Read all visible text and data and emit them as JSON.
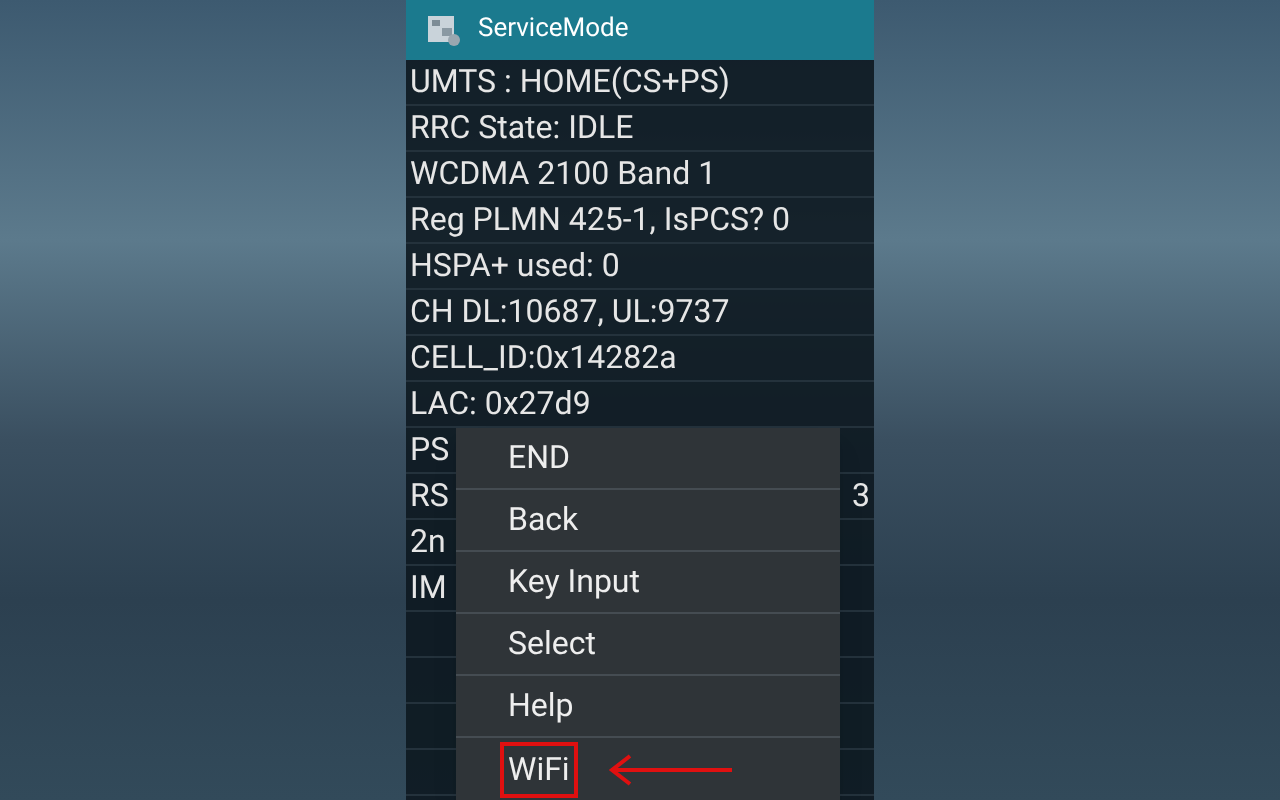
{
  "app_bar": {
    "title": "ServiceMode"
  },
  "lines": [
    {
      "text": "UMTS : HOME(CS+PS)"
    },
    {
      "text": "RRC State: IDLE"
    },
    {
      "text": "WCDMA 2100 Band 1"
    },
    {
      "text": "Reg PLMN 425-1, IsPCS? 0"
    },
    {
      "text": "HSPA+ used: 0"
    },
    {
      "text": "CH DL:10687, UL:9737"
    },
    {
      "text": "CELL_ID:0x14282a"
    },
    {
      "text": "LAC: 0x27d9"
    },
    {
      "text": "PS"
    },
    {
      "text": "RS",
      "tail": "3"
    },
    {
      "text": "2n"
    },
    {
      "text": "IM"
    }
  ],
  "menu": {
    "items": [
      {
        "label": "END",
        "highlighted": false
      },
      {
        "label": "Back",
        "highlighted": false
      },
      {
        "label": "Key Input",
        "highlighted": false
      },
      {
        "label": "Select",
        "highlighted": false
      },
      {
        "label": "Help",
        "highlighted": false
      },
      {
        "label": "WiFi",
        "highlighted": true
      }
    ]
  }
}
